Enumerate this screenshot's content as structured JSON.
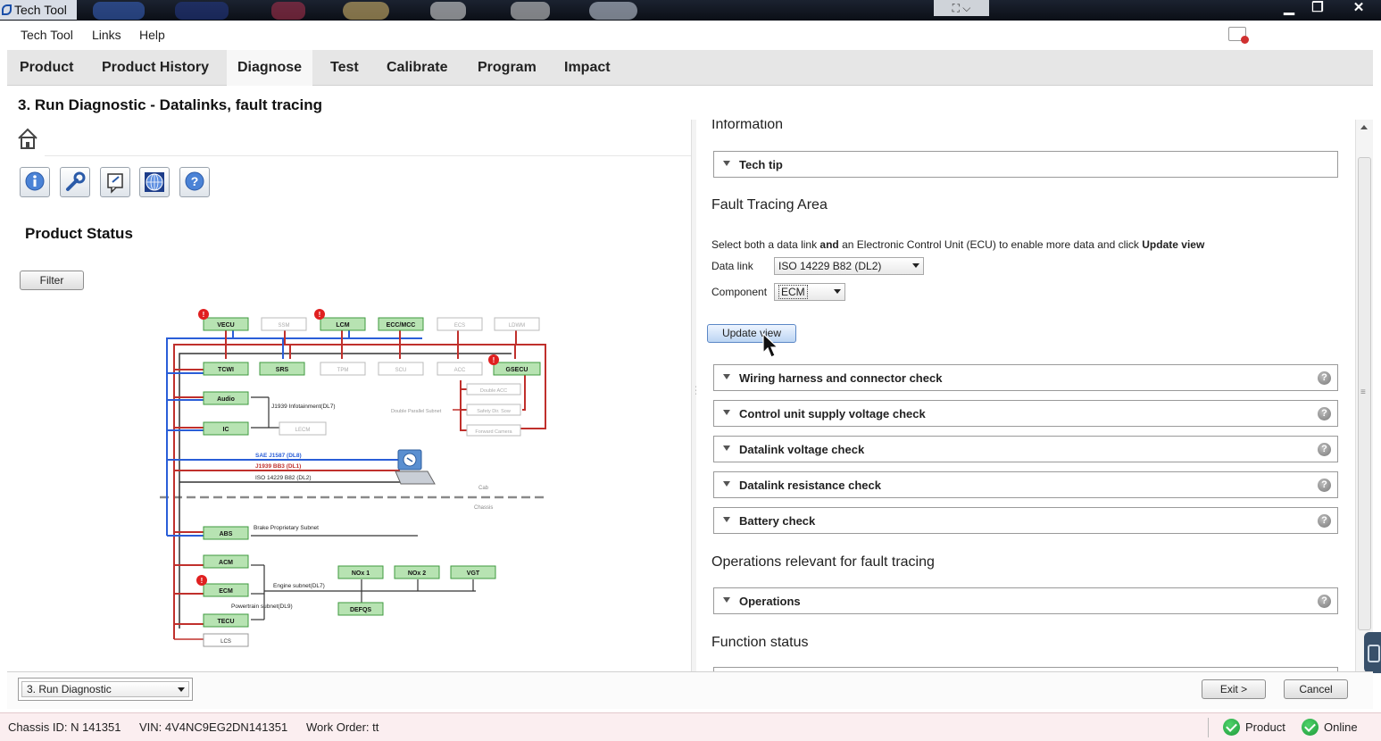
{
  "window": {
    "title": "Tech Tool",
    "zoom_hint": "⛶ ⌵"
  },
  "menu": {
    "items": [
      "Tech Tool",
      "Links",
      "Help"
    ]
  },
  "tabs": [
    "Product",
    "Product History",
    "Diagnose",
    "Test",
    "Calibrate",
    "Program",
    "Impact"
  ],
  "active_tab": "Diagnose",
  "page": {
    "title": "3. Run Diagnostic - Datalinks, fault tracing"
  },
  "left": {
    "product_status": "Product Status",
    "filter_label": "Filter",
    "toolbar_icons": [
      "info-icon",
      "tools-icon",
      "note-icon",
      "globe-icon",
      "help-icon"
    ],
    "diagram": {
      "nodes": [
        "VECU",
        "SSM",
        "LCM",
        "ECC/MCC",
        "ECS",
        "LDWM",
        "TCWI",
        "SRS",
        "TPM",
        "SCU",
        "ACC",
        "GSECU",
        "Audio",
        "IC",
        "LECM",
        "Double ACC",
        "Safety Dir. Sow",
        "Forward Camera",
        "ABS",
        "ACM",
        "ECM",
        "TECU",
        "LCS",
        "NOx 1",
        "NOx 2",
        "VGT",
        "DEFQS"
      ],
      "labels": [
        "J1939 Infotainment(DL7)",
        "Double Parallel Subnet",
        "SAE J1587 (DL8)",
        "J1939 BB3 (DL1)",
        "ISO 14229 B82 (DL2)",
        "Cab",
        "Chassis",
        "Brake Proprietary Subnet",
        "Engine subnet(DL7)",
        "Powertrain subnet(DL9)"
      ]
    }
  },
  "right": {
    "information_title": "Information",
    "tech_tip": "Tech tip",
    "fault_area_title": "Fault Tracing Area",
    "instruction": {
      "part1": "Select both a data link ",
      "bold1": "and",
      "part2": " an Electronic Control Unit (ECU) to enable more data and click ",
      "bold2": "Update view"
    },
    "datalink_label": "Data link",
    "datalink_value": "ISO 14229 B82 (DL2)",
    "component_label": "Component",
    "component_value": "ECM",
    "update_btn": "Update view",
    "checks": [
      "Wiring harness and connector check",
      "Control unit supply voltage check",
      "Datalink voltage check",
      "Datalink resistance check",
      "Battery check"
    ],
    "operations_title": "Operations relevant for fault tracing",
    "operations": "Operations",
    "function_status_title": "Function status",
    "help_glyph": "?"
  },
  "bottom": {
    "step": "3. Run Diagnostic",
    "exit": "Exit >",
    "cancel": "Cancel"
  },
  "status": {
    "chassis": "Chassis ID: N 141351",
    "vin": "VIN: 4V4NC9EG2DN141351",
    "work_order": "Work Order: tt",
    "product": "Product",
    "online": "Online"
  }
}
